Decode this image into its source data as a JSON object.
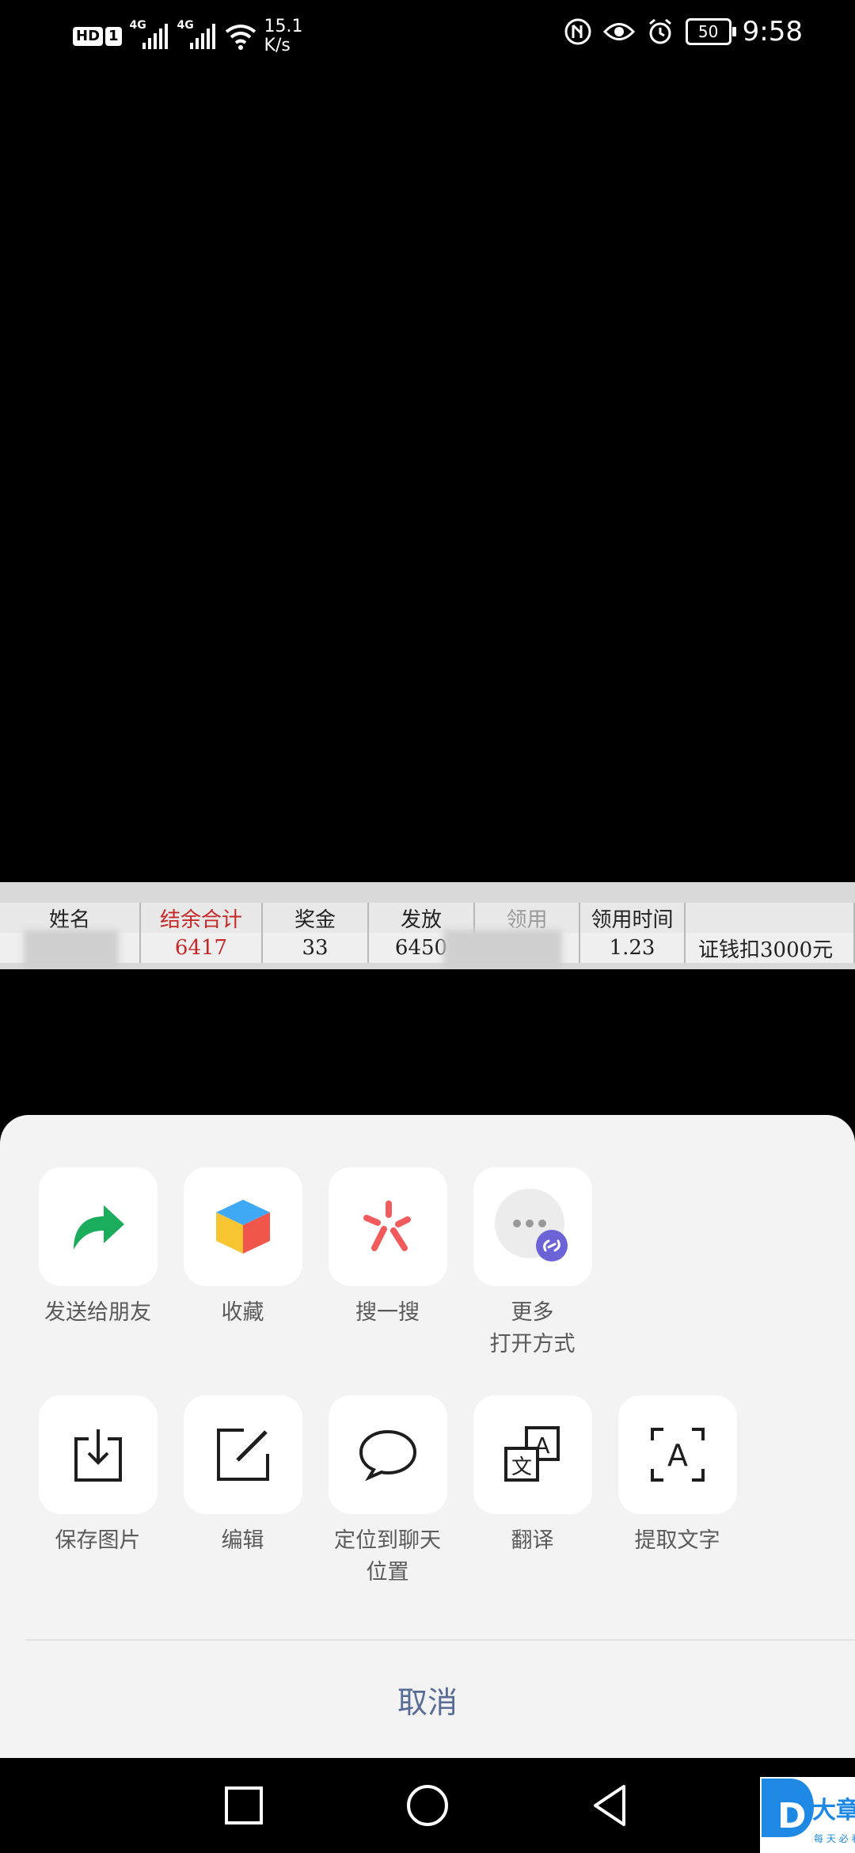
{
  "status_bar": {
    "hd_label": "HD",
    "sim_label": "1",
    "net1_label": "4G",
    "net2_label": "4G",
    "speed_value": "15.1",
    "speed_unit": "K/s",
    "battery_level": "50",
    "time": "9:58"
  },
  "image": {
    "header_cells": [
      "姓名",
      "结余合计",
      "奖金",
      "发放",
      "领用",
      "领用时间",
      ""
    ],
    "row_cells": [
      "",
      "6417",
      "33",
      "6450",
      "",
      "1.23",
      "证钱扣3000元"
    ]
  },
  "share_sheet": {
    "row1": [
      {
        "label": "发送给朋友",
        "icon": "forward-arrow-icon"
      },
      {
        "label": "收藏",
        "icon": "favorites-cube-icon"
      },
      {
        "label": "搜一搜",
        "icon": "search-spark-icon"
      },
      {
        "label": "更多\n打开方式",
        "icon": "more-open-with-icon"
      }
    ],
    "row2": [
      {
        "label": "保存图片",
        "icon": "save-image-icon"
      },
      {
        "label": "编辑",
        "icon": "edit-icon"
      },
      {
        "label": "定位到聊天\n位置",
        "icon": "chat-bubble-icon"
      },
      {
        "label": "翻译",
        "icon": "translate-icon"
      },
      {
        "label": "提取文字",
        "icon": "extract-text-icon"
      }
    ],
    "cancel_label": "取消"
  },
  "watermark": {
    "brand": "大章丘",
    "tagline": "每 天 必 看"
  },
  "colors": {
    "accent_green": "#1AAD5B",
    "cancel_blue": "#576B95",
    "sheet_bg": "#F3F3F3"
  }
}
